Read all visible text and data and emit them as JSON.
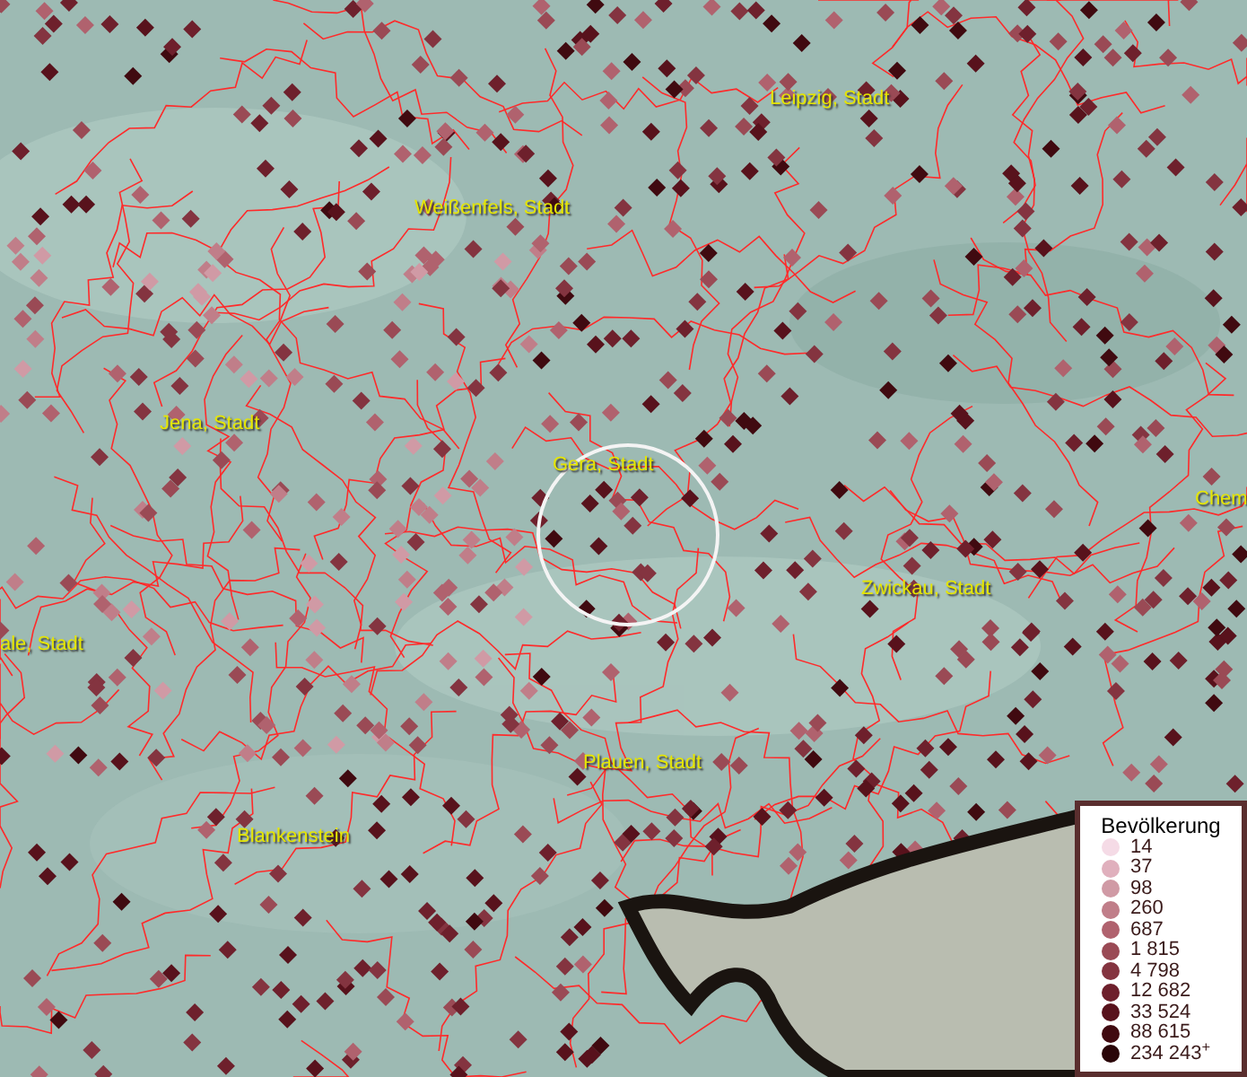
{
  "map_labels": [
    {
      "text": "Leipzig, Stadt"
    },
    {
      "text": "Weißenfels, Stadt"
    },
    {
      "text": "Jena, Stadt"
    },
    {
      "text": "Gera, Stadt"
    },
    {
      "text": "Chem"
    },
    {
      "text": "Zwickau, Stadt"
    },
    {
      "text": "ale, Stadt"
    },
    {
      "text": "Plauen, Stadt"
    },
    {
      "text": "Blankenstein"
    }
  ],
  "legend": {
    "title": "Bevölkerung",
    "items": [
      {
        "label": "14",
        "color": "#f5dbe6"
      },
      {
        "label": "37",
        "color": "#e0b0bd"
      },
      {
        "label": "98",
        "color": "#d09aa5"
      },
      {
        "label": "260",
        "color": "#c07e89"
      },
      {
        "label": "687",
        "color": "#b0626e"
      },
      {
        "label": "1 815",
        "color": "#9a4a55"
      },
      {
        "label": "4 798",
        "color": "#843440"
      },
      {
        "label": "12 682",
        "color": "#6e202c"
      },
      {
        "label": "33 524",
        "color": "#58121c"
      },
      {
        "label": "88 615",
        "color": "#400a10"
      },
      {
        "label": "234 243$^{+}$",
        "color": "#2a0508"
      }
    ]
  }
}
